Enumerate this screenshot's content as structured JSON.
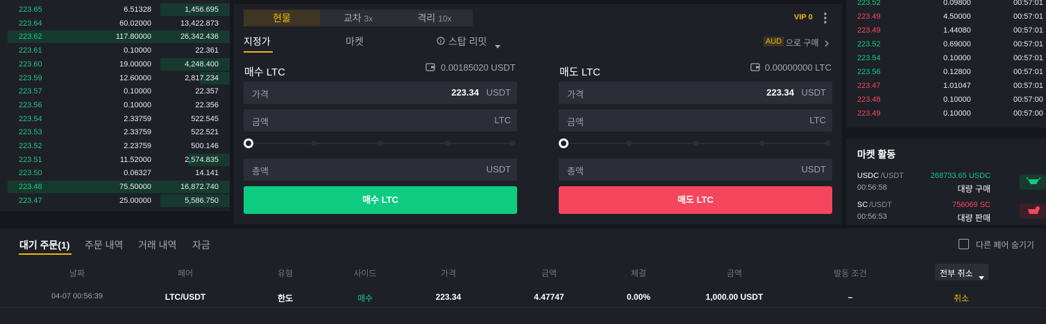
{
  "orderbook": {
    "rows": [
      {
        "price": "223.65",
        "amount": "6.51328",
        "total": "1,456.695"
      },
      {
        "price": "223.64",
        "amount": "60.02000",
        "total": "13,422.873"
      },
      {
        "price": "223.62",
        "amount": "117.80000",
        "total": "26,342.436"
      },
      {
        "price": "223.61",
        "amount": "0.10000",
        "total": "22.361"
      },
      {
        "price": "223.60",
        "amount": "19.00000",
        "total": "4,248.400"
      },
      {
        "price": "223.59",
        "amount": "12.60000",
        "total": "2,817.234"
      },
      {
        "price": "223.57",
        "amount": "0.10000",
        "total": "22.357"
      },
      {
        "price": "223.56",
        "amount": "0.10000",
        "total": "22.356"
      },
      {
        "price": "223.54",
        "amount": "2.33759",
        "total": "522.545"
      },
      {
        "price": "223.53",
        "amount": "2.33759",
        "total": "522.521"
      },
      {
        "price": "223.52",
        "amount": "2.23759",
        "total": "500.146"
      },
      {
        "price": "223.51",
        "amount": "11.52000",
        "total": "2,574.835"
      },
      {
        "price": "223.50",
        "amount": "0.06327",
        "total": "14.141"
      },
      {
        "price": "223.48",
        "amount": "75.50000",
        "total": "16,872.740"
      },
      {
        "price": "223.47",
        "amount": "25.00000",
        "total": "5,586.750"
      }
    ]
  },
  "trade": {
    "tabs": [
      {
        "label": "현물",
        "suffix": ""
      },
      {
        "label": "교차",
        "suffix": "3x"
      },
      {
        "label": "격리",
        "suffix": "10x"
      }
    ],
    "vip": "VIP 0",
    "order_types": [
      "지정가",
      "마켓",
      "스탑 리밋"
    ],
    "buy_with_badge": "AUD",
    "buy_with_text": "으로 구매",
    "buy": {
      "title": "매수 LTC",
      "available": "0.00185020 USDT",
      "price_label": "가격",
      "price_value": "223.34",
      "price_unit": "USDT",
      "amount_label": "금액",
      "amount_unit": "LTC",
      "total_label": "총액",
      "total_unit": "USDT",
      "button": "매수 LTC"
    },
    "sell": {
      "title": "매도 LTC",
      "available": "0.00000000 LTC",
      "price_label": "가격",
      "price_value": "223.34",
      "price_unit": "USDT",
      "amount_label": "금액",
      "amount_unit": "LTC",
      "total_label": "총액",
      "total_unit": "USDT",
      "button": "매도 LTC"
    },
    "colors": {
      "buy": "#0ecb81",
      "sell": "#f6465d",
      "accent": "#f0b90b"
    }
  },
  "trades": [
    {
      "price": "223.52",
      "amount": "0.09800",
      "time": "00:57:01",
      "side": "buy"
    },
    {
      "price": "223.49",
      "amount": "4.50000",
      "time": "00:57:01",
      "side": "sell"
    },
    {
      "price": "223.49",
      "amount": "1.44080",
      "time": "00:57:01",
      "side": "sell"
    },
    {
      "price": "223.52",
      "amount": "0.69000",
      "time": "00:57:01",
      "side": "buy"
    },
    {
      "price": "223.54",
      "amount": "0.10000",
      "time": "00:57:01",
      "side": "buy"
    },
    {
      "price": "223.56",
      "amount": "0.12800",
      "time": "00:57:01",
      "side": "buy"
    },
    {
      "price": "223.47",
      "amount": "1.01047",
      "time": "00:57:01",
      "side": "sell"
    },
    {
      "price": "223.48",
      "amount": "0.10000",
      "time": "00:57:00",
      "side": "sell"
    },
    {
      "price": "223.49",
      "amount": "0.10000",
      "time": "00:57:00",
      "side": "sell"
    }
  ],
  "market": {
    "title": "마켓 활동",
    "items": [
      {
        "base": "USDC",
        "quote": "/USDT",
        "time": "00:56:58",
        "value": "268733.65 USDC",
        "label": "대량 구매",
        "side": "buy"
      },
      {
        "base": "SC",
        "quote": "/USDT",
        "time": "00:56:53",
        "value": "756069 SC",
        "label": "대량 판매",
        "side": "sell"
      }
    ]
  },
  "orders": {
    "tabs": [
      "대기 주문(1)",
      "주문 내역",
      "거래 내역",
      "자금"
    ],
    "hide_pairs": "다른 페어 숨기기",
    "headers": [
      "날짜",
      "페어",
      "유형",
      "사이드",
      "가격",
      "금액",
      "체결",
      "금액",
      "발동 조건"
    ],
    "cancel_all": "전부 취소",
    "row": {
      "date": "04-07 00:56:39",
      "pair": "LTC/USDT",
      "type": "한도",
      "side": "매수",
      "price": "223.34",
      "amount": "4.47747",
      "filled": "0.00%",
      "total": "1,000.00 USDT",
      "trigger": "–",
      "action": "취소"
    }
  }
}
